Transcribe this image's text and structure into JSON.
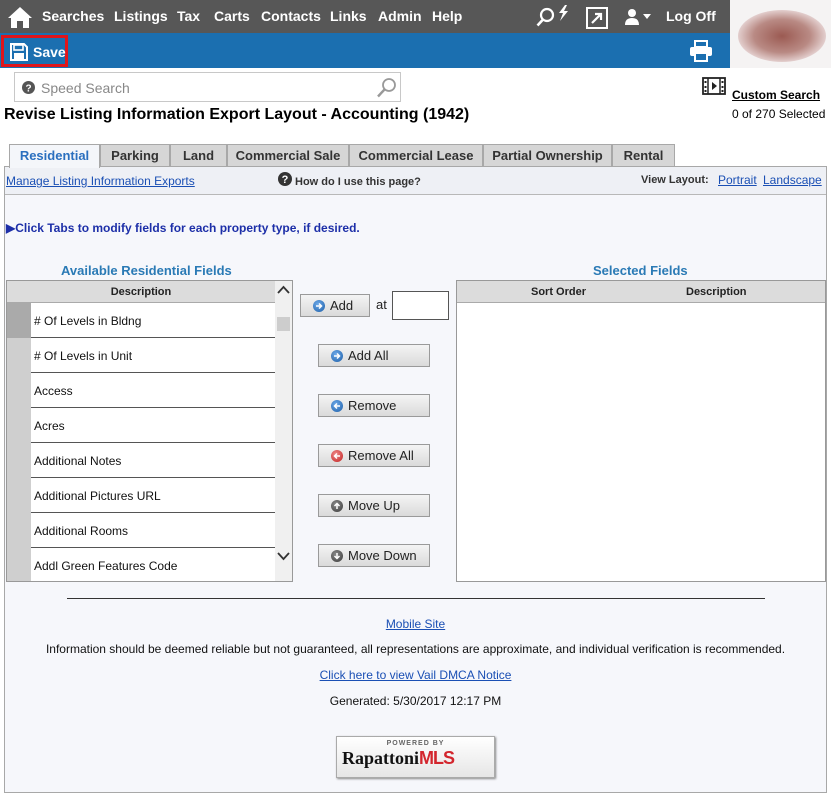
{
  "nav": {
    "items": [
      "Searches",
      "Listings",
      "Tax",
      "Carts",
      "Contacts",
      "Links",
      "Admin",
      "Help"
    ],
    "logoff": "Log Off"
  },
  "toolbar": {
    "save_label": "Save"
  },
  "search": {
    "placeholder": "Speed Search"
  },
  "custom_search": {
    "label": "Custom Search",
    "count": "0 of 270 Selected"
  },
  "page": {
    "title": "Revise Listing Information Export Layout - Accounting (1942)"
  },
  "tabs": [
    "Residential",
    "Parking",
    "Land",
    "Commercial Sale",
    "Commercial Lease",
    "Partial Ownership",
    "Rental"
  ],
  "subbar": {
    "manage_link": "Manage Listing Information Exports",
    "help": "How do I use this page?",
    "view_layout": "View Layout:",
    "portrait": "Portrait",
    "landscape": "Landscape"
  },
  "instruction": "▶Click Tabs to modify fields for each property type, if desired.",
  "available": {
    "title": "Available Residential Fields",
    "header": "Description",
    "fields": [
      "# Of Levels in Bldng",
      "# Of Levels in Unit",
      "Access",
      "Acres",
      "Additional Notes",
      "Additional Pictures URL",
      "Additional Rooms",
      "Addl Green Features Code"
    ]
  },
  "controls": {
    "add": "Add",
    "at": "at",
    "at_value": "",
    "add_all": "Add All",
    "remove": "Remove",
    "remove_all": "Remove All",
    "move_up": "Move Up",
    "move_down": "Move Down"
  },
  "selected": {
    "title": "Selected Fields",
    "col_sort": "Sort Order",
    "col_desc": "Description"
  },
  "footer": {
    "mobile": "Mobile Site",
    "disclaimer": "Information should be deemed reliable but not guaranteed, all representations are approximate, and individual verification is recommended.",
    "dmca": "Click here to view Vail DMCA Notice",
    "generated": "Generated: 5/30/2017 12:17 PM",
    "logo_powered": "POWERED BY",
    "logo_name": "Rapattoni",
    "logo_mls": "MLS"
  },
  "colors": {
    "nav_bg": "#575757",
    "toolbar_bg": "#1b6fb0",
    "save_highlight": "#e0151b",
    "accent_title": "#2a7ab5",
    "link": "#1a4fb4"
  }
}
